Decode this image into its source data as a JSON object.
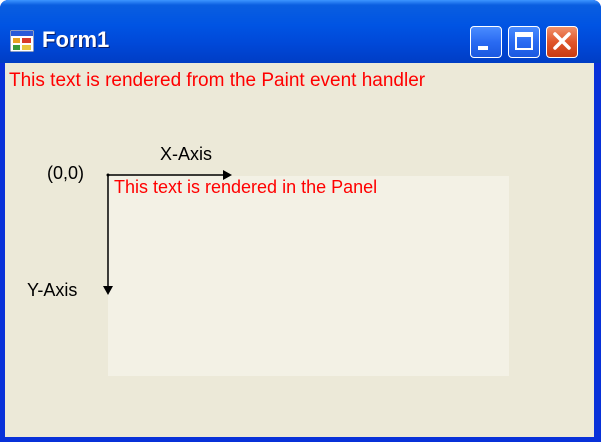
{
  "window": {
    "title": "Form1",
    "icon": "app-form-icon",
    "buttons": {
      "minimize": "minimize-icon",
      "maximize": "maximize-icon",
      "close": "close-icon"
    }
  },
  "client": {
    "paint_text": "This text is rendered from the Paint event handler",
    "panel_text": "This text is rendered in the Panel",
    "origin_label": "(0,0)",
    "x_axis_label": "X-Axis",
    "y_axis_label": "Y-Axis"
  },
  "colors": {
    "title_bar": "#0054e3",
    "client_bg": "#ece9d8",
    "panel_bg": "#f3f1e5",
    "text_red": "#ff0000"
  }
}
